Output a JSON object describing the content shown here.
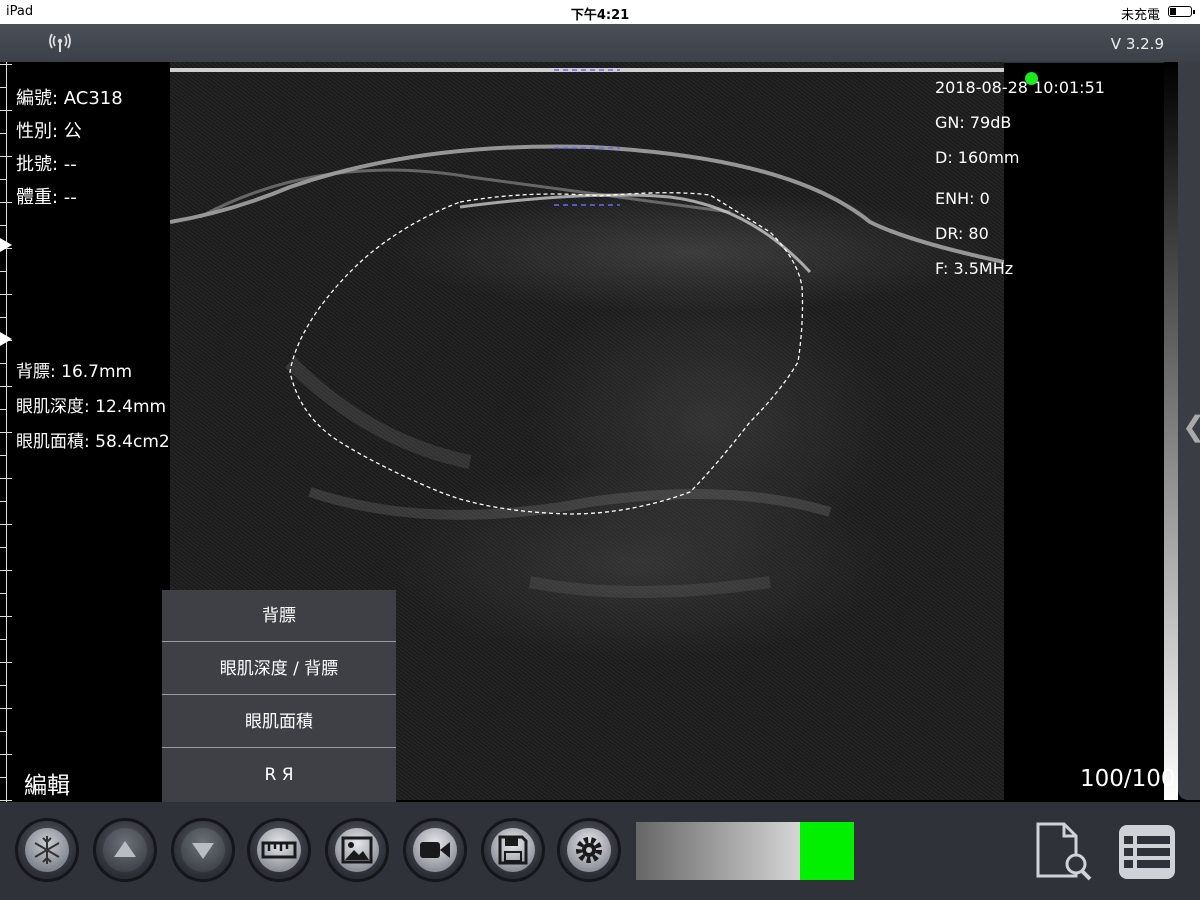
{
  "status_bar": {
    "device": "iPad",
    "time": "下午4:21",
    "charging": "未充電"
  },
  "top_bar": {
    "version": "V 3.2.9",
    "icon": "wireless-signal-icon"
  },
  "patient": {
    "id": "編號: AC318",
    "sex": "性別: 公",
    "batch": "批號: --",
    "weight": "體重: --"
  },
  "measurements": {
    "backfat": "背膘: 16.7mm",
    "loin_depth": "眼肌深度: 12.4mm",
    "loin_area": "眼肌面積: 58.4cm2"
  },
  "scan_params": {
    "datetime": "2018-08-28 10:01:51",
    "gain": "GN: 79dB",
    "depth": "D: 160mm",
    "enhance": "ENH: 0",
    "dynamic_range": "DR: 80",
    "frequency": "F: 3.5MHz"
  },
  "edit_label": "編輯",
  "frame_counter": "100/100",
  "menu": {
    "items": [
      {
        "label": "背膘"
      },
      {
        "label": "眼肌深度 / 背膘"
      },
      {
        "label": "眼肌面積"
      },
      {
        "label": "R Я"
      }
    ]
  },
  "toolbar": {
    "buttons": [
      "freeze-icon",
      "up-arrow-icon",
      "down-arrow-icon",
      "ruler-icon",
      "image-icon",
      "video-camera-icon",
      "save-icon",
      "gear-icon"
    ],
    "gain_fill_color": "#00f000",
    "right_icons": [
      "document-search-icon",
      "list-icon"
    ]
  },
  "colors": {
    "accent_green": "#00f000",
    "indicator_dot": "#1ee81e",
    "background": "#000000",
    "toolbar": "#2f3239"
  }
}
